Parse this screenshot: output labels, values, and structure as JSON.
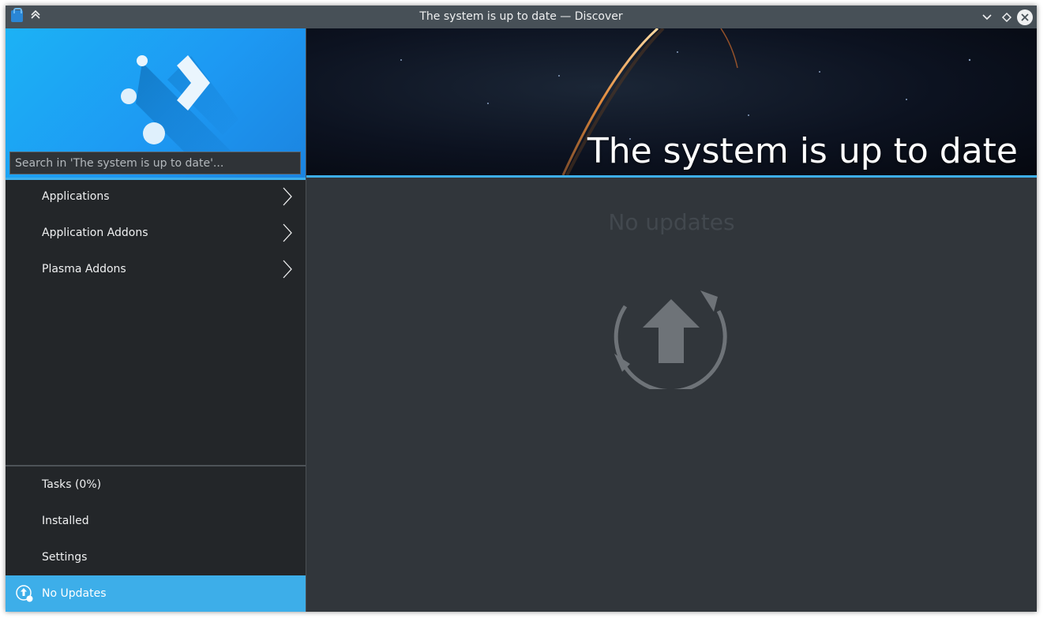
{
  "window": {
    "title": "The system is up to date — Discover",
    "app_icon": "discover-app-icon",
    "buttons": [
      "keep-above-icon",
      "minimize-icon",
      "maximize-icon",
      "close-icon"
    ]
  },
  "sidebar": {
    "search_placeholder": "Search in 'The system is up to date'...",
    "categories": [
      {
        "label": "Applications",
        "icon": "chevron-right-icon"
      },
      {
        "label": "Application Addons",
        "icon": "chevron-right-icon"
      },
      {
        "label": "Plasma Addons",
        "icon": "chevron-right-icon"
      }
    ],
    "actions": [
      {
        "label": "Tasks (0%)"
      },
      {
        "label": "Installed"
      },
      {
        "label": "Settings"
      }
    ],
    "status": {
      "label": "No Updates",
      "icon": "update-status-icon"
    }
  },
  "main": {
    "banner_title": "The system is up to date",
    "empty_state_title": "No updates",
    "empty_state_icon": "system-update-icon"
  },
  "colors": {
    "accent": "#3daee9",
    "sidebar_bg": "#232629",
    "content_bg": "#31363b",
    "titlebar_bg": "#475057"
  }
}
